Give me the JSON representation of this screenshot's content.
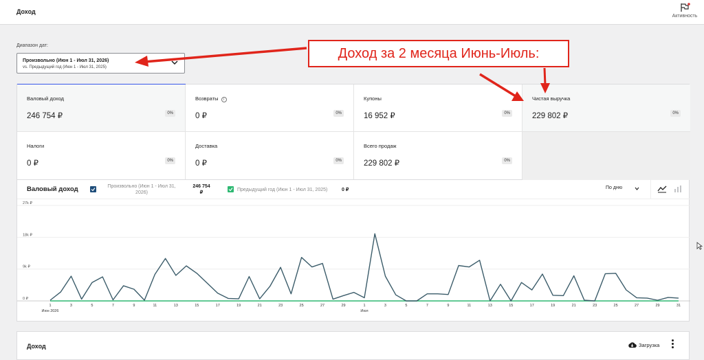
{
  "header": {
    "title": "Доход",
    "activity_label": "Активность"
  },
  "date_range": {
    "label": "Диапазон дат:",
    "selected": "Произвольно (Июн 1 - Июл 31, 2026)",
    "compare": "vs. Предыдущий год (Июн 1 - Июл 31, 2025)"
  },
  "annotation": {
    "text": "Доход за 2 месяца Июнь-Июль:",
    "color": "#e0251b"
  },
  "stats": [
    {
      "label": "Валовый доход",
      "value": "246 754 ₽",
      "delta": "0%"
    },
    {
      "label": "Возвраты",
      "value": "0 ₽",
      "delta": "0%"
    },
    {
      "label": "Купоны",
      "value": "16 952 ₽",
      "delta": "0%"
    },
    {
      "label": "Чистая выручка",
      "value": "229 802 ₽",
      "delta": "0%"
    },
    {
      "label": "Налоги",
      "value": "0 ₽",
      "delta": "0%"
    },
    {
      "label": "Доставка",
      "value": "0 ₽",
      "delta": "0%"
    },
    {
      "label": "Всего продаж",
      "value": "229 802 ₽",
      "delta": "0%"
    }
  ],
  "chart_header": {
    "title": "Валовый доход",
    "legend_current": "Произвольно (Июн 1 - Июл 31, 2026)",
    "legend_current_value": "246 754 ₽",
    "legend_previous": "Предыдущий год (Июн 1 - Июл 31, 2025)",
    "legend_previous_value": "0 ₽",
    "interval": "По дню"
  },
  "chart_data": {
    "type": "line",
    "y_ticks": [
      "27k ₽",
      "18k ₽",
      "9k ₽",
      "0 ₽"
    ],
    "ylim": [
      0,
      27000
    ],
    "x_tick_labels": [
      "1",
      "3",
      "5",
      "7",
      "9",
      "11",
      "13",
      "15",
      "17",
      "19",
      "21",
      "23",
      "25",
      "27",
      "29",
      "1",
      "3",
      "5",
      "7",
      "9",
      "11",
      "13",
      "15",
      "17",
      "19",
      "21",
      "23",
      "25",
      "27",
      "29",
      "31"
    ],
    "x_sub_labels": [
      {
        "under": "1",
        "index": 0,
        "text": "Июн 2026"
      },
      {
        "under": "1",
        "index": 30,
        "text": "Июл"
      }
    ],
    "grid": true,
    "colors": {
      "current": "#3b5c6a",
      "previous": "#2eb872"
    },
    "series": [
      {
        "name": "Произвольно (Июн 1 - Июл 31, 2026)",
        "values": [
          200,
          2500,
          7000,
          500,
          5200,
          6800,
          300,
          4300,
          3300,
          200,
          7500,
          12000,
          7200,
          9900,
          7800,
          5000,
          2200,
          700,
          600,
          6900,
          600,
          4200,
          9500,
          2000,
          12300,
          9600,
          10600,
          500,
          1500,
          2400,
          900,
          19000,
          7000,
          1700,
          0,
          0,
          2000,
          2000,
          1800,
          10000,
          9600,
          11500,
          0,
          4700,
          0,
          5200,
          3100,
          7600,
          1600,
          1500,
          7100,
          200,
          0,
          7700,
          7800,
          3100,
          900,
          800,
          200,
          1000,
          800
        ]
      },
      {
        "name": "Предыдущий год (Июн 1 - Июл 31, 2025)",
        "values": [
          0,
          0,
          0,
          0,
          0,
          0,
          0,
          0,
          0,
          0,
          0,
          0,
          0,
          0,
          0,
          0,
          0,
          0,
          0,
          0,
          0,
          0,
          0,
          0,
          0,
          0,
          0,
          0,
          0,
          0,
          0,
          0,
          0,
          0,
          0,
          0,
          0,
          0,
          0,
          0,
          0,
          0,
          0,
          0,
          0,
          0,
          0,
          0,
          0,
          0,
          0,
          0,
          0,
          0,
          0,
          0,
          0,
          0,
          0,
          0,
          0
        ]
      }
    ]
  },
  "income_section": {
    "title": "Доход",
    "download_label": "Загрузка"
  }
}
